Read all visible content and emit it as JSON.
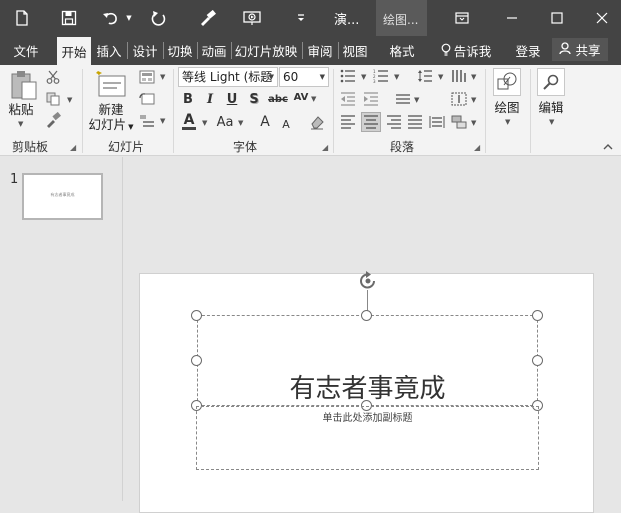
{
  "titlebar": {
    "doc_title": "演...",
    "context_group": "绘图...",
    "icons": [
      "new-file-icon",
      "save-icon",
      "undo-icon",
      "redo-icon",
      "format-painter-icon",
      "slideshow-icon",
      "ribbon-display-icon",
      "minimize-icon",
      "maximize-icon",
      "close-icon"
    ]
  },
  "tabs": [
    {
      "label": "文件",
      "active": false
    },
    {
      "label": "开始",
      "active": true
    },
    {
      "label": "插入",
      "active": false
    },
    {
      "label": "设计",
      "active": false
    },
    {
      "label": "切换",
      "active": false
    },
    {
      "label": "动画",
      "active": false
    },
    {
      "label": "幻灯片放映",
      "active": false
    },
    {
      "label": "审阅",
      "active": false
    },
    {
      "label": "视图",
      "active": false
    },
    {
      "label": "格式",
      "active": false
    }
  ],
  "tell_me": "告诉我",
  "login": "登录",
  "share": "共享",
  "ribbon": {
    "clipboard": {
      "paste": "粘贴",
      "group": "剪贴板"
    },
    "slides": {
      "new_slide_line1": "新建",
      "new_slide_line2": "幻灯片",
      "group": "幻灯片"
    },
    "font": {
      "font_name": "等线 Light (标题",
      "font_size": "60",
      "bold": "B",
      "italic": "I",
      "underline": "U",
      "shadow": "S",
      "strike": "abc",
      "spacing": "AV",
      "font_color": "A",
      "case": "Aa",
      "grow": "A",
      "shrink": "A",
      "group": "字体"
    },
    "paragraph": {
      "group": "段落"
    },
    "drawing": {
      "label": "绘图"
    },
    "editing": {
      "label": "编辑"
    }
  },
  "thumbnails": [
    {
      "number": "1",
      "text": "有志者事竟成"
    }
  ],
  "slide": {
    "title": "有志者事竟成",
    "subtitle_placeholder": "单击此处添加副标题"
  }
}
